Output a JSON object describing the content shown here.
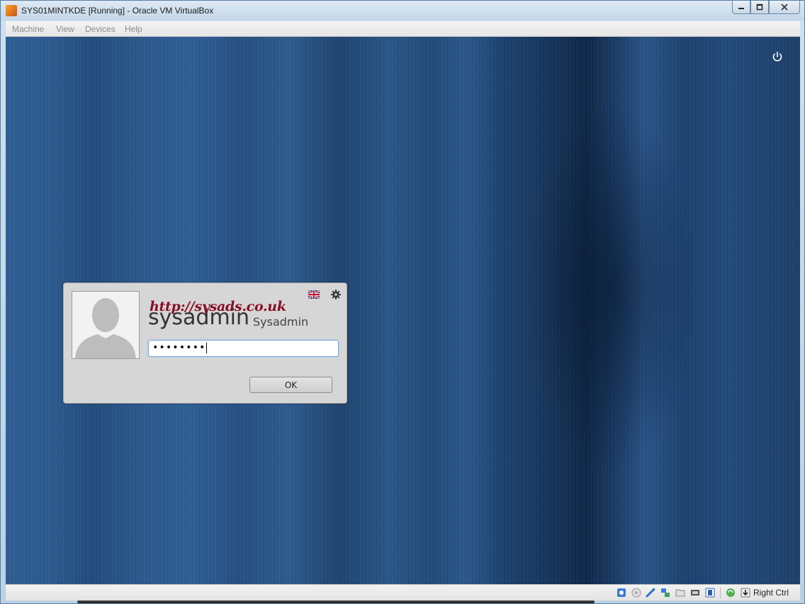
{
  "window": {
    "title": "SYS01MINTKDE [Running] - Oracle VM VirtualBox",
    "app_icon": "virtualbox-icon",
    "controls": [
      "minimize-icon",
      "maximize-icon",
      "close-icon"
    ]
  },
  "menubar": {
    "items": [
      {
        "label": "Machine"
      },
      {
        "label": "View"
      },
      {
        "label": "Devices"
      },
      {
        "label": "Help"
      }
    ]
  },
  "vm_screen": {
    "power_icon": "power-icon"
  },
  "login": {
    "watermark": "http://sysads.co.uk",
    "username": "sysadmin",
    "real_name": "Sysadmin",
    "password_masked": "••••••••",
    "ok_label": "OK",
    "icons": [
      "avatar-silhouette-icon",
      "uk-flag-icon",
      "gear-icon"
    ]
  },
  "statusbar": {
    "icons": [
      "hard-disk-icon",
      "optical-drive-icon",
      "usb-icon",
      "network-icon",
      "shared-folders-icon",
      "video-capture-icon",
      "display-icon",
      "guest-additions-icon",
      "mouse-integration-icon"
    ],
    "host_key": "Right Ctrl"
  },
  "colors": {
    "desktop_blue": "#2a5689",
    "watermark_red": "#8a0f24",
    "dialog_gray": "#d6d6d6"
  }
}
